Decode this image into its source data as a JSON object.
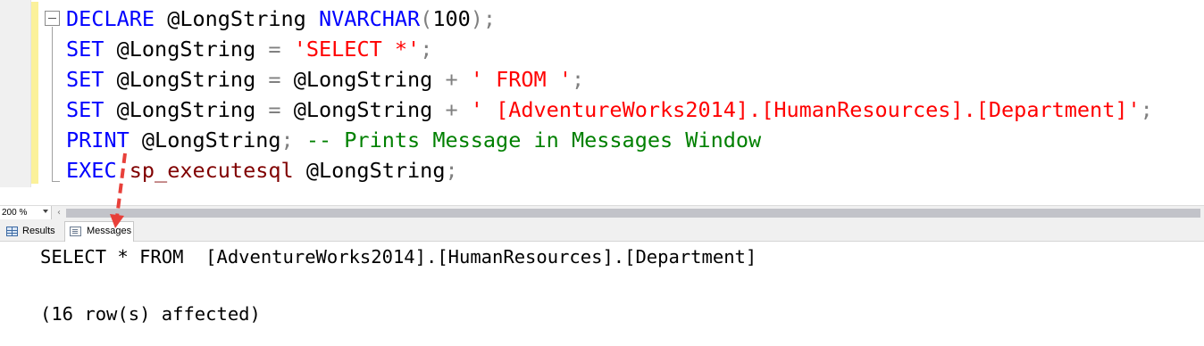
{
  "editor": {
    "lines": [
      [
        {
          "t": "DECLARE",
          "c": "kw"
        },
        {
          "t": " @LongString ",
          "c": "plain"
        },
        {
          "t": "NVARCHAR",
          "c": "kw"
        },
        {
          "t": "(",
          "c": "op"
        },
        {
          "t": "100",
          "c": "plain"
        },
        {
          "t": ");",
          "c": "op"
        }
      ],
      [
        {
          "t": "SET",
          "c": "kw"
        },
        {
          "t": " @LongString ",
          "c": "plain"
        },
        {
          "t": "=",
          "c": "op"
        },
        {
          "t": " ",
          "c": "plain"
        },
        {
          "t": "'SELECT *'",
          "c": "str"
        },
        {
          "t": ";",
          "c": "op"
        }
      ],
      [
        {
          "t": "SET",
          "c": "kw"
        },
        {
          "t": " @LongString ",
          "c": "plain"
        },
        {
          "t": "=",
          "c": "op"
        },
        {
          "t": " @LongString ",
          "c": "plain"
        },
        {
          "t": "+",
          "c": "op"
        },
        {
          "t": " ",
          "c": "plain"
        },
        {
          "t": "' FROM '",
          "c": "str"
        },
        {
          "t": ";",
          "c": "op"
        }
      ],
      [
        {
          "t": "SET",
          "c": "kw"
        },
        {
          "t": " @LongString ",
          "c": "plain"
        },
        {
          "t": "=",
          "c": "op"
        },
        {
          "t": " @LongString ",
          "c": "plain"
        },
        {
          "t": "+",
          "c": "op"
        },
        {
          "t": " ",
          "c": "plain"
        },
        {
          "t": "' [AdventureWorks2014].[HumanResources].[Department]'",
          "c": "str"
        },
        {
          "t": ";",
          "c": "op"
        }
      ],
      [
        {
          "t": "PRINT",
          "c": "kw"
        },
        {
          "t": " @LongString",
          "c": "plain"
        },
        {
          "t": ";",
          "c": "op"
        },
        {
          "t": " -- Prints Message in Messages Window",
          "c": "cm"
        }
      ],
      [
        {
          "t": "EXEC",
          "c": "kw"
        },
        {
          "t": " ",
          "c": "plain"
        },
        {
          "t": "sp_executesql",
          "c": "sp"
        },
        {
          "t": " @LongString",
          "c": "plain"
        },
        {
          "t": ";",
          "c": "op"
        }
      ]
    ]
  },
  "zoom": {
    "level": "200 %"
  },
  "tabs": {
    "results_label": "Results",
    "messages_label": "Messages",
    "active": "Messages"
  },
  "messages": {
    "line1": "SELECT * FROM  [AdventureWorks2014].[HumanResources].[Department]",
    "line2": "",
    "line3": "(16 row(s) affected)"
  },
  "colors": {
    "keyword": "#0000ff",
    "string": "#ff0000",
    "comment": "#008000",
    "system_proc": "#800000",
    "operator": "#808080",
    "annotation_arrow": "#e8403a",
    "change_bar": "#fbf19a"
  },
  "icons": {
    "results_tab": "grid-icon",
    "messages_tab": "message-icon",
    "collapse": "collapse-minus-icon",
    "scroll_left": "scroll-left-arrow-icon",
    "zoom_dropdown": "chevron-down-icon"
  }
}
